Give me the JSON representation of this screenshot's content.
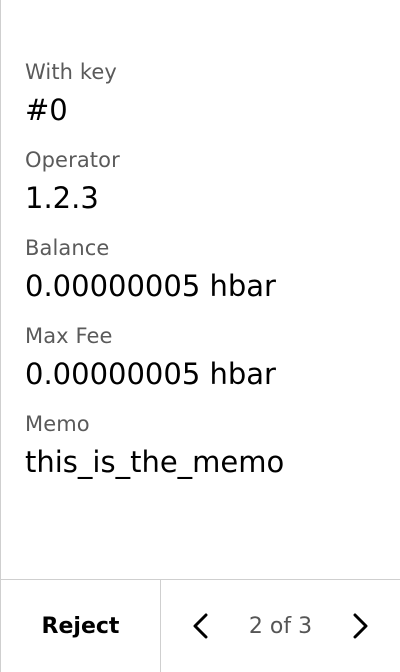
{
  "fields": [
    {
      "label": "With key",
      "value": "#0"
    },
    {
      "label": "Operator",
      "value": "1.2.3"
    },
    {
      "label": "Balance",
      "value": "0.00000005 hbar"
    },
    {
      "label": "Max Fee",
      "value": "0.00000005 hbar"
    },
    {
      "label": "Memo",
      "value": "this_is_the_memo"
    }
  ],
  "footer": {
    "reject_label": "Reject",
    "page_indicator": "2 of 3",
    "prev_icon": "chevron-left-icon",
    "next_icon": "chevron-right-icon"
  }
}
